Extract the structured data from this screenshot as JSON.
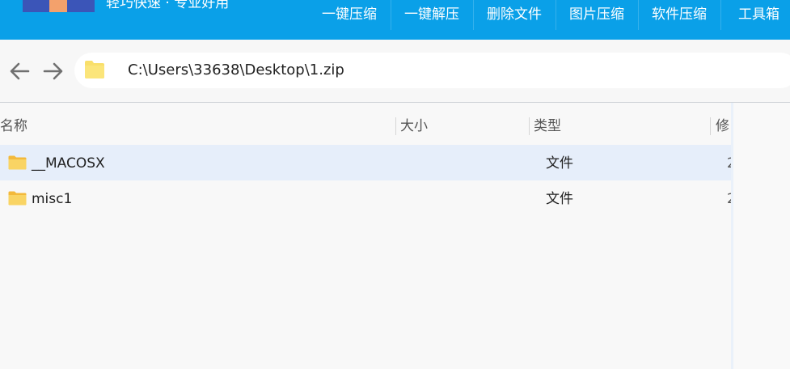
{
  "app": {
    "title": "轻巧快速 · 专业好用",
    "logo_colors": [
      "#3b55b8",
      "#f3a16c",
      "#3b55b8"
    ]
  },
  "menu": [
    {
      "label": "一键压缩"
    },
    {
      "label": "一键解压"
    },
    {
      "label": "删除文件"
    },
    {
      "label": "图片压缩"
    },
    {
      "label": "软件压缩"
    },
    {
      "label": "工具箱"
    }
  ],
  "nav": {
    "back_icon": "arrow-left-icon",
    "forward_icon": "arrow-right-icon"
  },
  "address": {
    "path": "C:\\Users\\33638\\Desktop\\1.zip",
    "icon": "folder-icon"
  },
  "columns": [
    {
      "label": "名称"
    },
    {
      "label": "大小"
    },
    {
      "label": "类型"
    },
    {
      "label": "修"
    }
  ],
  "rows": [
    {
      "name": "__MACOSX",
      "size": "",
      "type": "文件",
      "modified": "2",
      "selected": true
    },
    {
      "name": "misc1",
      "size": "",
      "type": "文件",
      "modified": "2",
      "selected": false
    }
  ],
  "colors": {
    "accent": "#0aa0e8",
    "selected_row": "#e6eefa",
    "folder": "#f7c64a"
  }
}
